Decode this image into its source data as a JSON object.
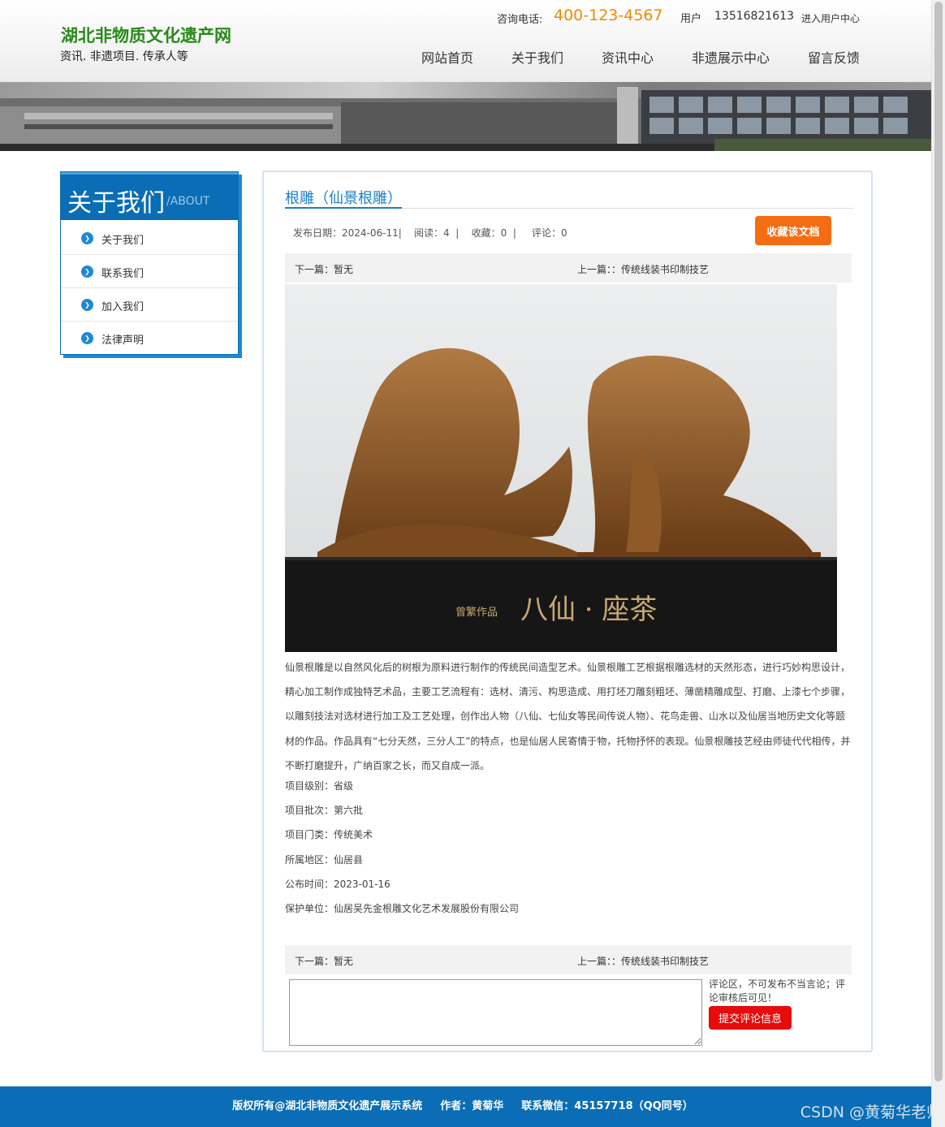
{
  "header": {
    "site_title": "湖北非物质文化遗产网",
    "site_subtitle": "资讯. 非遗项目. 传承人等",
    "phone_label": "咨询电话:",
    "phone": "400-123-4567",
    "user_label": "用户",
    "user_phone": "13516821613",
    "user_center": "进入用户中心",
    "nav": [
      "网站首页",
      "关于我们",
      "资讯中心",
      "非遗展示中心",
      "留言反馈"
    ]
  },
  "sidebar": {
    "title": "关于我们",
    "title_en": "/ABOUT",
    "items": [
      "关于我们",
      "联系我们",
      "加入我们",
      "法律声明"
    ]
  },
  "article": {
    "title": "根雕（仙景根雕）",
    "meta": "发布日期：2024-06-11|    阅读：4  |    收藏：0  |     评论：0",
    "favorite_button": "收藏该文档",
    "next_label": "下一篇：暂无",
    "prev_label": "上一篇：：传统线装书印制技艺",
    "image_caption": "曾繁作品 · 八仙·座茶",
    "body": "仙景根雕是以自然风化后的树根为原料进行制作的传统民间造型艺术。仙景根雕工艺根据根雕选材的天然形态，进行巧妙构思设计，精心加工制作成独特艺术品，主要工艺流程有：选材、清污、构思造成、用打坯刀雕刻粗坯、薄凿精雕成型、打磨、上漆七个步骤，以雕刻技法对选材进行加工及工艺处理，创作出人物（八仙、七仙女等民间传说人物）、花鸟走兽、山水以及仙居当地历史文化等题材的作品。作品具有“七分天然，三分人工”的特点，也是仙居人民寄情于物，托物抒怀的表现。仙景根雕技艺经由师徒代代相传，并不断打磨提升，广纳百家之长，而又自成一派。",
    "info": [
      "项目级别：省级",
      "项目批次：第六批",
      "项目门类：传统美术",
      "所属地区：仙居县",
      "公布时间：2023-01-16",
      "保护单位：仙居吴先金根雕文化艺术发展股份有限公司"
    ]
  },
  "comment": {
    "placeholder": "",
    "note": "评论区，不可发布不当言论；评论审核后可见！",
    "submit_button": "提交评论信息"
  },
  "footer": {
    "copyright": "版权所有@湖北非物质文化遗产展示系统",
    "author": "作者：黄菊华",
    "contact": "联系微信：45157718（QQ同号）"
  },
  "watermark": "CSDN @黄菊华老师",
  "colors": {
    "brand_blue": "#0a6db5",
    "title_green": "#2a8a1a",
    "phone_orange": "#f08a00",
    "fav_orange": "#f46d12",
    "submit_red": "#e80b0b",
    "link_blue": "#1a7fc8"
  }
}
